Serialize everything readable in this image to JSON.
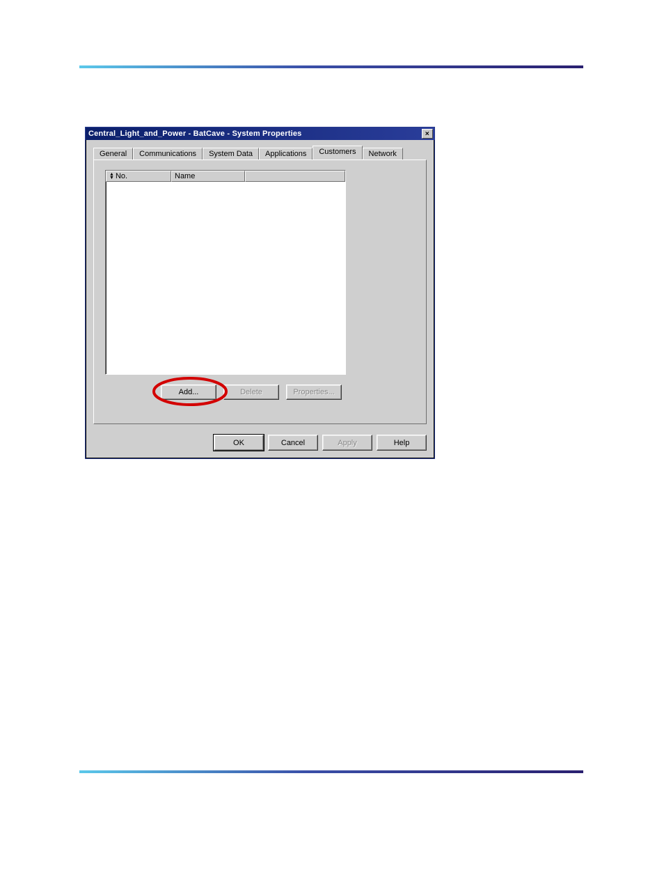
{
  "window": {
    "title": "Central_Light_and_Power - BatCave - System Properties"
  },
  "tabs": {
    "t0": {
      "label": "General"
    },
    "t1": {
      "label": "Communications"
    },
    "t2": {
      "label": "System Data"
    },
    "t3": {
      "label": "Applications"
    },
    "t4": {
      "label": "Customers"
    },
    "t5": {
      "label": "Network"
    }
  },
  "list": {
    "col_no": "No.",
    "col_name": "Name"
  },
  "panel_buttons": {
    "add": "Add...",
    "delete": "Delete",
    "properties": "Properties..."
  },
  "dialog_buttons": {
    "ok": "OK",
    "cancel": "Cancel",
    "apply": "Apply",
    "help": "Help"
  }
}
